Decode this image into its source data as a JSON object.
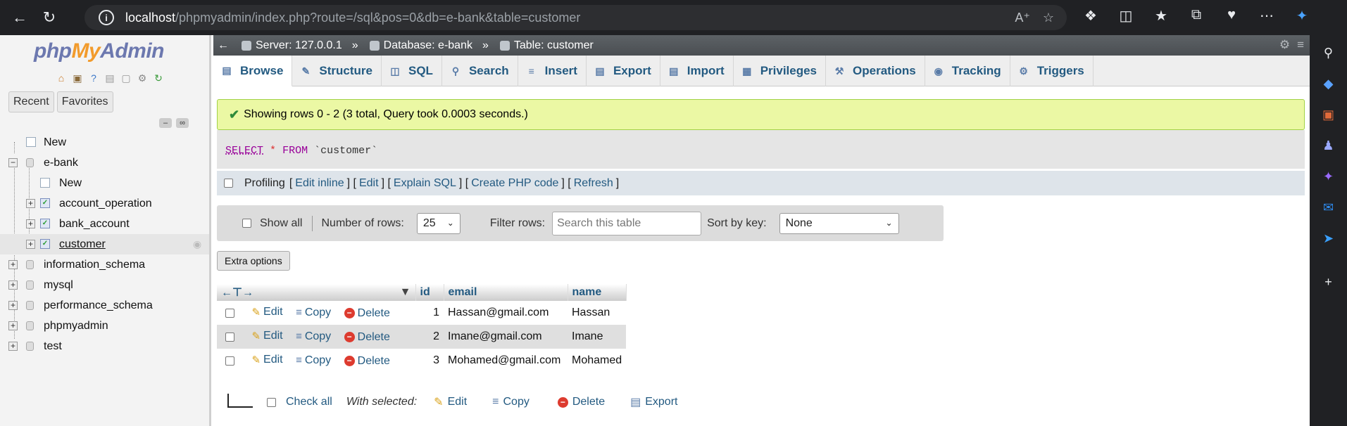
{
  "browser": {
    "url_host": "localhost",
    "url_path": "/phpmyadmin/index.php?route=/sql&pos=0&db=e-bank&table=customer",
    "back_icon": "back-arrow-icon",
    "reload_icon": "reload-icon"
  },
  "sidebar": {
    "logo_php": "php",
    "logo_my": "My",
    "logo_admin": "Admin",
    "recent_label": "Recent",
    "favorites_label": "Favorites",
    "tree": [
      {
        "label": "New",
        "level": 1,
        "type": "new"
      },
      {
        "label": "e-bank",
        "level": 0,
        "type": "db",
        "expanded": true
      },
      {
        "label": "New",
        "level": 2,
        "type": "new"
      },
      {
        "label": "account_operation",
        "level": 2,
        "type": "table"
      },
      {
        "label": "bank_account",
        "level": 2,
        "type": "table"
      },
      {
        "label": "customer",
        "level": 2,
        "type": "table",
        "selected": true
      },
      {
        "label": "information_schema",
        "level": 0,
        "type": "db"
      },
      {
        "label": "mysql",
        "level": 0,
        "type": "db"
      },
      {
        "label": "performance_schema",
        "level": 0,
        "type": "db"
      },
      {
        "label": "phpmyadmin",
        "level": 0,
        "type": "db"
      },
      {
        "label": "test",
        "level": 0,
        "type": "db"
      }
    ]
  },
  "breadcrumb": {
    "server": "Server: 127.0.0.1",
    "database": "Database: e-bank",
    "table": "Table: customer",
    "separator": "»"
  },
  "tabs": [
    {
      "label": "Browse",
      "icon": "browse-icon",
      "active": true
    },
    {
      "label": "Structure",
      "icon": "structure-icon"
    },
    {
      "label": "SQL",
      "icon": "sql-icon"
    },
    {
      "label": "Search",
      "icon": "search-icon"
    },
    {
      "label": "Insert",
      "icon": "insert-icon"
    },
    {
      "label": "Export",
      "icon": "export-icon"
    },
    {
      "label": "Import",
      "icon": "import-icon"
    },
    {
      "label": "Privileges",
      "icon": "privileges-icon"
    },
    {
      "label": "Operations",
      "icon": "operations-icon"
    },
    {
      "label": "Tracking",
      "icon": "tracking-icon"
    },
    {
      "label": "Triggers",
      "icon": "triggers-icon"
    }
  ],
  "message": {
    "success": "Showing rows 0 - 2 (3 total, Query took 0.0003 seconds.)"
  },
  "sql": {
    "select": "SELECT",
    "star": "*",
    "from": "FROM",
    "table": "`customer`"
  },
  "profiling": {
    "label": "Profiling",
    "links": [
      "Edit inline",
      "Edit",
      "Explain SQL",
      "Create PHP code",
      "Refresh"
    ]
  },
  "options": {
    "show_all_label": "Show all",
    "rows_label": "Number of rows:",
    "rows_value": "25",
    "filter_label": "Filter rows:",
    "filter_placeholder": "Search this table",
    "sort_label": "Sort by key:",
    "sort_value": "None",
    "extra_options": "Extra options"
  },
  "table": {
    "columns": [
      "id",
      "email",
      "name"
    ],
    "rows": [
      {
        "id": "1",
        "email": "Hassan@gmail.com",
        "name": "Hassan"
      },
      {
        "id": "2",
        "email": "Imane@gmail.com",
        "name": "Imane"
      },
      {
        "id": "3",
        "email": "Mohamed@gmail.com",
        "name": "Mohamed"
      }
    ],
    "edit_label": "Edit",
    "copy_label": "Copy",
    "delete_label": "Delete"
  },
  "bulk": {
    "check_all": "Check all",
    "with_selected": "With selected:",
    "edit": "Edit",
    "copy": "Copy",
    "delete": "Delete",
    "export": "Export"
  }
}
